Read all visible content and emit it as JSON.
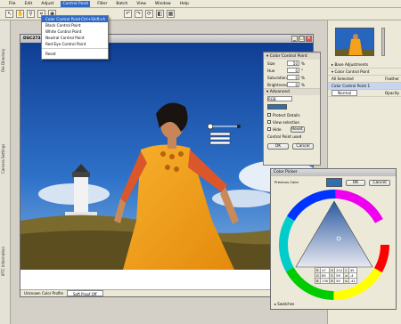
{
  "menubar": {
    "items": [
      "File",
      "Edit",
      "Adjust",
      "Control Point",
      "Filter",
      "Batch",
      "View",
      "Window",
      "Help"
    ],
    "active_index": 3
  },
  "toolbar": {
    "icons": [
      "arrow-icon",
      "hand-icon",
      "zoom-icon",
      "crop-icon",
      "cp-icon",
      "undo-icon",
      "redo-icon",
      "rotate-icon",
      "compare-icon",
      "grid-icon"
    ]
  },
  "dropdown": {
    "items": [
      {
        "label": "Color Control Point",
        "shortcut": "Ctrl+Shift+A",
        "highlighted": true
      },
      {
        "label": "Black Control Point",
        "shortcut": ""
      },
      {
        "label": "White Control Point",
        "shortcut": ""
      },
      {
        "label": "Neutral Control Point",
        "shortcut": ""
      },
      {
        "label": "Red-Eye Control Point",
        "shortcut": ""
      },
      {
        "label": "Reset",
        "shortcut": ""
      }
    ]
  },
  "left_strip": {
    "tabs": [
      "File Directory",
      "Camera Settings",
      "IPTC Information"
    ]
  },
  "document": {
    "title": "DSC2733",
    "status_profile": "Unknown Color Profile",
    "status_proof": "Soft Proof Off"
  },
  "control_point_panel": {
    "title": "Color Control Point",
    "rows": [
      {
        "label": "Size",
        "value": "50",
        "unit": "%"
      },
      {
        "label": "Hue",
        "value": "0",
        "unit": "°"
      },
      {
        "label": "Saturation",
        "value": "0",
        "unit": "%"
      },
      {
        "label": "Brightness",
        "value": "0",
        "unit": "%"
      }
    ],
    "advanced_label": "Advanced",
    "mode_value": "RGB",
    "checkboxes": [
      "Protect Details",
      "View selection",
      "Hide"
    ],
    "reset_label": "Reset",
    "footer": "Control Point used",
    "ok_label": "OK",
    "cancel_label": "Cancel"
  },
  "right_panel": {
    "adjustments": [
      "Base Adjustments",
      "Color Control Point",
      "All Selected",
      "Color Control Point 1",
      "Normal"
    ],
    "feather_label": "Feather",
    "opacity_label": "Opacity"
  },
  "color_picker": {
    "title": "Color Picker",
    "previous_label": "Previous Color",
    "ok_label": "OK",
    "cancel_label": "Cancel",
    "swatch_color": "#2f6fb0",
    "values": [
      {
        "k": "R",
        "v": "47"
      },
      {
        "k": "H",
        "v": "212"
      },
      {
        "k": "L",
        "v": "45"
      },
      {
        "k": "G",
        "v": "85"
      },
      {
        "k": "S",
        "v": "59"
      },
      {
        "k": "a",
        "v": "-4"
      },
      {
        "k": "B",
        "v": "130"
      },
      {
        "k": "B",
        "v": "50"
      },
      {
        "k": "b",
        "v": "-41"
      }
    ],
    "swatches_label": "Swatches"
  },
  "colors": {
    "accent": "#316ac5",
    "sky": "#1f5fb8",
    "dress": "#f5a11a",
    "close": "#d9534f"
  }
}
